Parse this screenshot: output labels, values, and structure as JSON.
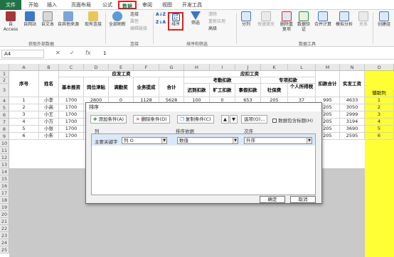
{
  "ribbon_tabs": [
    "文件",
    "开始",
    "插入",
    "页面布局",
    "公式",
    "数据",
    "审阅",
    "视图",
    "开发工具"
  ],
  "ribbon": {
    "get_external": [
      "自 Access",
      "自网站",
      "自文本",
      "自其他来源",
      "现有连接"
    ],
    "refresh_all": "全部刷新",
    "conn_items": [
      "连接",
      "属性",
      "编辑链接"
    ],
    "sort_asc": "A↓Z",
    "sort_desc": "Z↓A",
    "sort": "排序",
    "filter": "筛选",
    "filter_items": [
      "清除",
      "重新应用",
      "高级"
    ],
    "data_tools": [
      "分列",
      "快速填充",
      "删除重复项",
      "数据验证",
      "合并计算",
      "模拟分析",
      "关系"
    ],
    "create_group": "创建组",
    "group_labels": {
      "get": "获取外部数据",
      "conn": "连接",
      "sortfilter": "排序和筛选",
      "tools": "数据工具"
    }
  },
  "formula_bar": {
    "name_box": "A4",
    "fx": "fx",
    "value": "1"
  },
  "columns": [
    "A",
    "B",
    "C",
    "D",
    "E",
    "F",
    "G",
    "H",
    "I",
    "J",
    "K",
    "L",
    "M",
    "N",
    "O"
  ],
  "rows": [
    "1",
    "2",
    "3",
    "4",
    "5",
    "6",
    "7",
    "8",
    "9",
    "10",
    "11",
    "12",
    "13",
    "14",
    "15",
    "16",
    "17",
    "18",
    "19",
    "20",
    "21",
    "22",
    "23",
    "24",
    "25"
  ],
  "headers": {
    "xuhao": "序号",
    "name": "姓名",
    "yingfa": "应发工资",
    "jiben": "基本报资",
    "gangwei": "岗位津贴",
    "jiangjin": "满勤奖",
    "yewu": "业务提成",
    "heji": "合计",
    "yingkou": "应扣工资",
    "kaoqin": "考勤扣款",
    "chidao": "迟到扣款",
    "kuanggong": "旷工扣款",
    "shijia": "事假扣款",
    "zhuanxiang": "专项扣款",
    "shebao": "社保费",
    "geshui": "个人所得税",
    "koukuan": "扣款合计",
    "shifa": "实发工资",
    "fuzhu": "辅助列"
  },
  "table_rows": [
    {
      "no": "1",
      "name": "小李",
      "c": "1700",
      "d": "2800",
      "e": "0",
      "f": "1128",
      "g": "5628",
      "h": "100",
      "i": "0",
      "j": "653",
      "k": "205",
      "l": "37",
      "m": "995",
      "n": "4633",
      "o": "1"
    },
    {
      "no": "2",
      "name": "小高",
      "c": "1700",
      "d": "",
      "e": "",
      "f": "",
      "g": "",
      "h": "",
      "i": "",
      "j": "",
      "k": "",
      "l": "",
      "m": "205",
      "n": "3050",
      "o": "2"
    },
    {
      "no": "3",
      "name": "小王",
      "c": "1700",
      "d": "",
      "e": "",
      "f": "",
      "g": "",
      "h": "",
      "i": "",
      "j": "",
      "k": "",
      "l": "",
      "m": "205",
      "n": "2999",
      "o": "3"
    },
    {
      "no": "4",
      "name": "小万",
      "c": "1700",
      "d": "",
      "e": "",
      "f": "",
      "g": "",
      "h": "",
      "i": "",
      "j": "",
      "k": "",
      "l": "",
      "m": "205",
      "n": "3194",
      "o": "4"
    },
    {
      "no": "5",
      "name": "小张",
      "c": "1700",
      "d": "",
      "e": "",
      "f": "",
      "g": "",
      "h": "",
      "i": "",
      "j": "",
      "k": "",
      "l": "",
      "m": "205",
      "n": "3690",
      "o": "5"
    },
    {
      "no": "6",
      "name": "小朱",
      "c": "1700",
      "d": "",
      "e": "",
      "f": "",
      "g": "",
      "h": "",
      "i": "",
      "j": "",
      "k": "",
      "l": "",
      "m": "205",
      "n": "2595",
      "o": "6"
    }
  ],
  "dialog": {
    "title": "排序",
    "add": "添加条件(A)",
    "delete": "删除条件(D)",
    "copy": "复制条件(C)",
    "options": "选项(O)...",
    "has_header": "数据包含标题(H)",
    "col_label": "列",
    "basis_label": "排序依据",
    "order_label": "次序",
    "primary_key": "主要关键字",
    "key_value": "列 O",
    "basis_value": "数值",
    "order_value": "升序",
    "ok": "确定",
    "cancel": "取消"
  },
  "colors": {
    "excel_green": "#217346",
    "highlight_red": "#e02020",
    "helper_yellow": "#ffff33"
  }
}
